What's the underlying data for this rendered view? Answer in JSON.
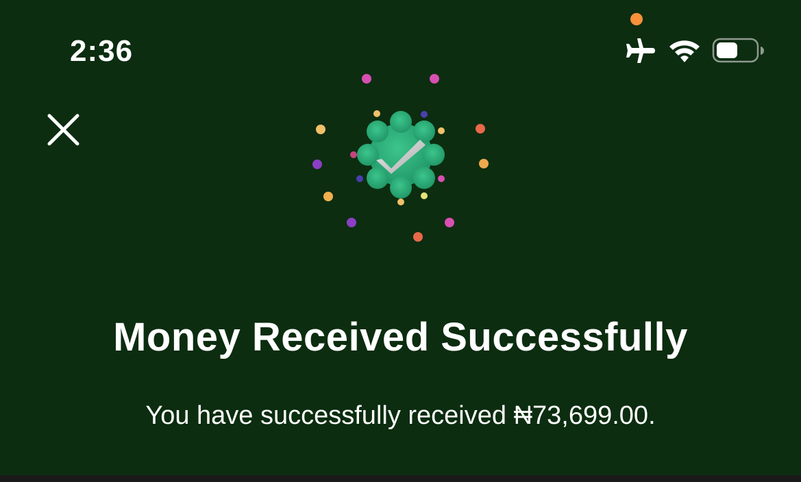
{
  "status_bar": {
    "time": "2:36",
    "icons": [
      "airplane-mode-icon",
      "wifi-icon",
      "battery-icon"
    ],
    "privacy_indicator_color": "#f7913a"
  },
  "header": {
    "close_icon": "close-icon"
  },
  "illustration": {
    "icon": "success-check-badge-icon",
    "badge_color": "#2bb27a",
    "confetti_colors": [
      "#d84fb2",
      "#f0c06a",
      "#e8684a",
      "#8a3fc4",
      "#4a3fb0",
      "#f1a94e",
      "#e3e37a"
    ]
  },
  "content": {
    "title": "Money Received Successfully",
    "message": "You have successfully received ₦73,699.00."
  },
  "colors": {
    "background": "#0c2d10",
    "text": "#ffffff",
    "bottom_strip": "#1a1a1a"
  }
}
